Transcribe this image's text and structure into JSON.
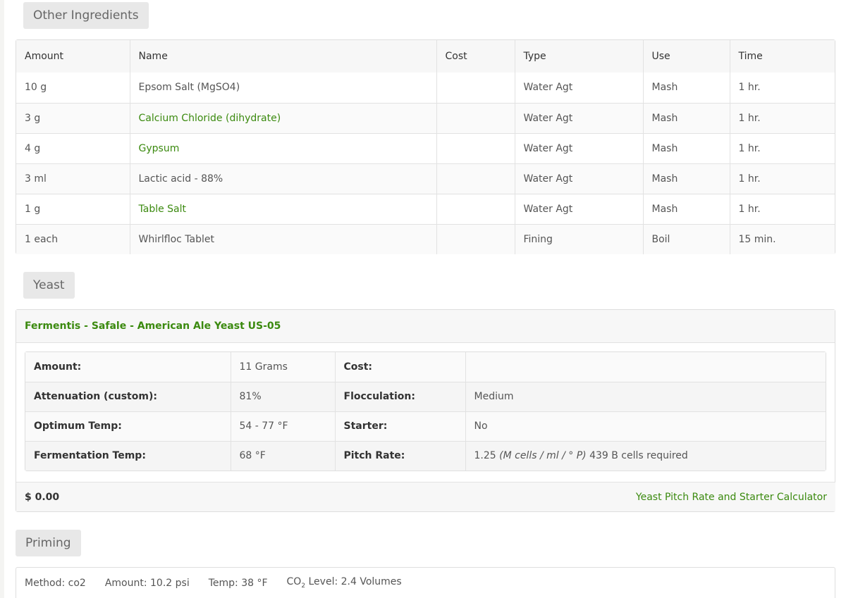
{
  "other_ingredients": {
    "title": "Other Ingredients",
    "columns": [
      "Amount",
      "Name",
      "Cost",
      "Type",
      "Use",
      "Time"
    ],
    "rows": [
      {
        "amount": "10 g",
        "name": "Epsom Salt (MgSO4)",
        "cost": "",
        "type": "Water Agt",
        "use": "Mash",
        "time": "1 hr."
      },
      {
        "amount": "3 g",
        "name": "Calcium Chloride (dihydrate)",
        "cost": "",
        "type": "Water Agt",
        "use": "Mash",
        "time": "1 hr."
      },
      {
        "amount": "4 g",
        "name": "Gypsum",
        "cost": "",
        "type": "Water Agt",
        "use": "Mash",
        "time": "1 hr."
      },
      {
        "amount": "3 ml",
        "name": "Lactic acid - 88%",
        "cost": "",
        "type": "Water Agt",
        "use": "Mash",
        "time": "1 hr."
      },
      {
        "amount": "1 g",
        "name": "Table Salt",
        "cost": "",
        "type": "Water Agt",
        "use": "Mash",
        "time": "1 hr."
      },
      {
        "amount": "1 each",
        "name": "Whirlfloc Tablet",
        "cost": "",
        "type": "Fining",
        "use": "Boil",
        "time": "15 min."
      }
    ]
  },
  "yeast": {
    "title": "Yeast",
    "name": "Fermentis - Safale - American Ale Yeast US-05",
    "amount_label": "Amount:",
    "amount_value": "11 Grams",
    "cost_label": "Cost:",
    "cost_value": "",
    "attenuation_label": "Attenuation (custom):",
    "attenuation_value": "81%",
    "flocculation_label": "Flocculation:",
    "flocculation_value": "Medium",
    "optimum_temp_label": "Optimum Temp:",
    "optimum_temp_value": "54 - 77 °F",
    "starter_label": "Starter:",
    "starter_value": "No",
    "fermentation_temp_label": "Fermentation Temp:",
    "fermentation_temp_value": "68 °F",
    "pitch_rate_label": "Pitch Rate:",
    "pitch_rate_number": "1.25",
    "pitch_rate_unit": "(M cells / ml / ° P)",
    "pitch_rate_required": "439 B cells required",
    "total_cost": "$ 0.00",
    "calculator_link": "Yeast Pitch Rate and Starter Calculator"
  },
  "priming": {
    "title": "Priming",
    "method": "Method: co2",
    "amount": "Amount: 10.2 psi",
    "temp": "Temp: 38 °F",
    "co2_prefix": "CO",
    "co2_sub": "2",
    "co2_suffix": " Level: 2.4 Volumes"
  },
  "colors": {
    "accent_green": "#3b8a0f",
    "tag_bg": "#e8e8e8"
  }
}
